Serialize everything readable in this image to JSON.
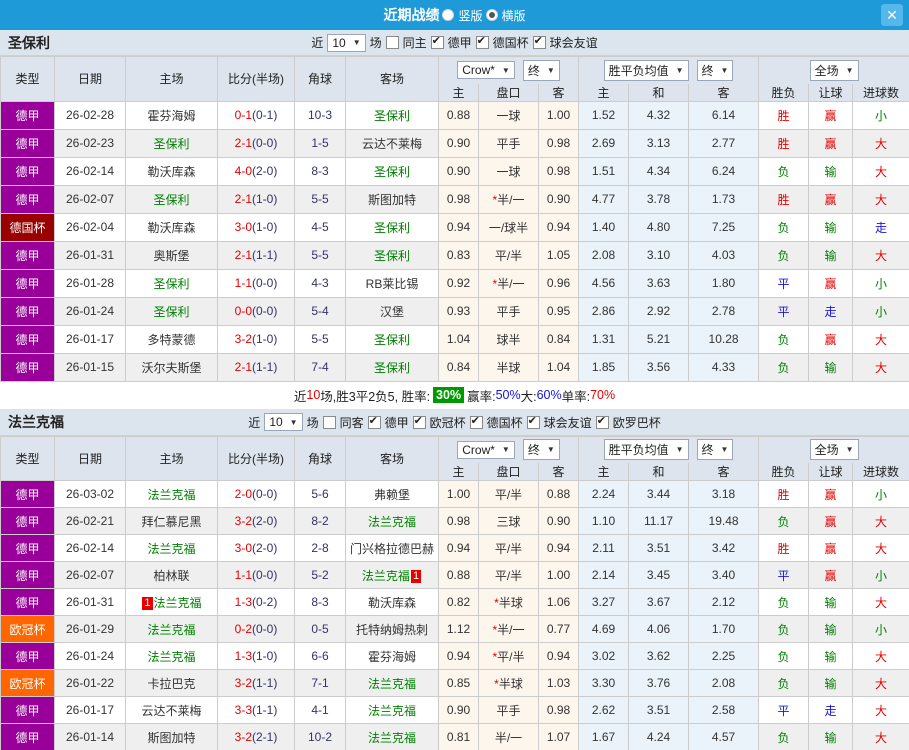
{
  "titlebar": {
    "title": "近期战绩",
    "radio_vertical": "竖版",
    "radio_horizontal": "横版",
    "selected": "横版",
    "close": "✕"
  },
  "colors": {
    "titlebar_blue": "#1e9ad8",
    "league": {
      "德甲": "#990099",
      "德国杯": "#990000",
      "欧冠杯": "#ff6600"
    },
    "result_map": {
      "胜": "#e60000",
      "负": "#008000",
      "平": "#1414dc",
      "赢": "#e60000",
      "输": "#008000",
      "走": "#1414dc",
      "大": "#e60000",
      "小": "#008000"
    },
    "team_green": "#008000",
    "score_red": "#e60000"
  },
  "table_header": {
    "main": [
      "类型",
      "日期",
      "主场",
      "比分(半场)",
      "角球",
      "客场"
    ],
    "sub": [
      "主",
      "盘口",
      "客",
      "主",
      "和",
      "客",
      "胜负",
      "让球",
      "进球数"
    ],
    "odds_source": "Crow*",
    "final1": "终",
    "mean_label": "胜平负均值",
    "final2": "终",
    "fulltime_label": "全场"
  },
  "sections": [
    {
      "team": "圣保利",
      "controls": {
        "near": "近",
        "count": "10",
        "games": "场",
        "same": {
          "label": "同主",
          "checked": false
        },
        "leagues": [
          {
            "label": "德甲",
            "checked": true
          },
          {
            "label": "德国杯",
            "checked": true
          },
          {
            "label": "球会友谊",
            "checked": true
          }
        ]
      },
      "rows": [
        {
          "type": "德甲",
          "date": "26-02-28",
          "home": "霍芬海姆",
          "home_green": false,
          "ft": "0-1",
          "ht": "(0-1)",
          "corner": "10-3",
          "away": "圣保利",
          "away_green": true,
          "o1": "0.88",
          "star": false,
          "hc": "一球",
          "o2": "1.00",
          "m1": "1.52",
          "m2": "4.32",
          "m3": "6.14",
          "res": "胜",
          "hres": "赢",
          "goals": "小"
        },
        {
          "type": "德甲",
          "date": "26-02-23",
          "home": "圣保利",
          "home_green": true,
          "ft": "2-1",
          "ht": "(0-0)",
          "corner": "1-5",
          "away": "云达不莱梅",
          "away_green": false,
          "o1": "0.90",
          "star": false,
          "hc": "平手",
          "o2": "0.98",
          "m1": "2.69",
          "m2": "3.13",
          "m3": "2.77",
          "res": "胜",
          "hres": "赢",
          "goals": "大"
        },
        {
          "type": "德甲",
          "date": "26-02-14",
          "home": "勒沃库森",
          "home_green": false,
          "ft": "4-0",
          "ht": "(2-0)",
          "corner": "8-3",
          "away": "圣保利",
          "away_green": true,
          "o1": "0.90",
          "star": false,
          "hc": "一球",
          "o2": "0.98",
          "m1": "1.51",
          "m2": "4.34",
          "m3": "6.24",
          "res": "负",
          "hres": "输",
          "goals": "大"
        },
        {
          "type": "德甲",
          "date": "26-02-07",
          "home": "圣保利",
          "home_green": true,
          "ft": "2-1",
          "ht": "(1-0)",
          "corner": "5-5",
          "away": "斯图加特",
          "away_green": false,
          "o1": "0.98",
          "star": true,
          "hc": "半/一",
          "o2": "0.90",
          "m1": "4.77",
          "m2": "3.78",
          "m3": "1.73",
          "res": "胜",
          "hres": "赢",
          "goals": "大"
        },
        {
          "type": "德国杯",
          "date": "26-02-04",
          "home": "勒沃库森",
          "home_green": false,
          "ft": "3-0",
          "ht": "(1-0)",
          "corner": "4-5",
          "away": "圣保利",
          "away_green": true,
          "o1": "0.94",
          "star": false,
          "hc": "一/球半",
          "o2": "0.94",
          "m1": "1.40",
          "m2": "4.80",
          "m3": "7.25",
          "res": "负",
          "hres": "输",
          "goals": "走"
        },
        {
          "type": "德甲",
          "date": "26-01-31",
          "home": "奥斯堡",
          "home_green": false,
          "ft": "2-1",
          "ht": "(1-1)",
          "corner": "5-5",
          "away": "圣保利",
          "away_green": true,
          "o1": "0.83",
          "star": false,
          "hc": "平/半",
          "o2": "1.05",
          "m1": "2.08",
          "m2": "3.10",
          "m3": "4.03",
          "res": "负",
          "hres": "输",
          "goals": "大"
        },
        {
          "type": "德甲",
          "date": "26-01-28",
          "home": "圣保利",
          "home_green": true,
          "ft": "1-1",
          "ht": "(0-0)",
          "corner": "4-3",
          "away": "RB莱比锡",
          "away_green": false,
          "o1": "0.92",
          "star": true,
          "hc": "半/一",
          "o2": "0.96",
          "m1": "4.56",
          "m2": "3.63",
          "m3": "1.80",
          "res": "平",
          "hres": "赢",
          "goals": "小"
        },
        {
          "type": "德甲",
          "date": "26-01-24",
          "home": "圣保利",
          "home_green": true,
          "ft": "0-0",
          "ht": "(0-0)",
          "corner": "5-4",
          "away": "汉堡",
          "away_green": false,
          "o1": "0.93",
          "star": false,
          "hc": "平手",
          "o2": "0.95",
          "m1": "2.86",
          "m2": "2.92",
          "m3": "2.78",
          "res": "平",
          "hres": "走",
          "goals": "小"
        },
        {
          "type": "德甲",
          "date": "26-01-17",
          "home": "多特蒙德",
          "home_green": false,
          "ft": "3-2",
          "ht": "(1-0)",
          "corner": "5-5",
          "away": "圣保利",
          "away_green": true,
          "o1": "1.04",
          "star": false,
          "hc": "球半",
          "o2": "0.84",
          "m1": "1.31",
          "m2": "5.21",
          "m3": "10.28",
          "res": "负",
          "hres": "赢",
          "goals": "大"
        },
        {
          "type": "德甲",
          "date": "26-01-15",
          "home": "沃尔夫斯堡",
          "home_green": false,
          "ft": "2-1",
          "ht": "(1-1)",
          "corner": "7-4",
          "away": "圣保利",
          "away_green": true,
          "o1": "0.84",
          "star": false,
          "hc": "半球",
          "o2": "1.04",
          "m1": "1.85",
          "m2": "3.56",
          "m3": "4.33",
          "res": "负",
          "hres": "输",
          "goals": "大"
        }
      ],
      "summary": [
        {
          "t": "近",
          "c": "k"
        },
        {
          "t": "10",
          "c": "r"
        },
        {
          "t": "场,胜3平2负5, 胜率: ",
          "c": "k"
        },
        {
          "t": "30%",
          "c": "badge"
        },
        {
          "t": " 赢率:",
          "c": "k"
        },
        {
          "t": "50%",
          "c": "b"
        },
        {
          "t": " 大:",
          "c": "k"
        },
        {
          "t": "60%",
          "c": "b"
        },
        {
          "t": " 单率:",
          "c": "k"
        },
        {
          "t": "70%",
          "c": "r"
        }
      ]
    },
    {
      "team": "法兰克福",
      "controls": {
        "near": "近",
        "count": "10",
        "games": "场",
        "same": {
          "label": "同客",
          "checked": false
        },
        "leagues": [
          {
            "label": "德甲",
            "checked": true
          },
          {
            "label": "欧冠杯",
            "checked": true
          },
          {
            "label": "德国杯",
            "checked": true
          },
          {
            "label": "球会友谊",
            "checked": true
          },
          {
            "label": "欧罗巴杯",
            "checked": true
          }
        ]
      },
      "rows": [
        {
          "type": "德甲",
          "date": "26-03-02",
          "home": "法兰克福",
          "home_green": true,
          "ft": "2-0",
          "ht": "(0-0)",
          "corner": "5-6",
          "away": "弗赖堡",
          "away_green": false,
          "o1": "1.00",
          "star": false,
          "hc": "平/半",
          "o2": "0.88",
          "m1": "2.24",
          "m2": "3.44",
          "m3": "3.18",
          "res": "胜",
          "hres": "赢",
          "goals": "小"
        },
        {
          "type": "德甲",
          "date": "26-02-21",
          "home": "拜仁慕尼黑",
          "home_green": false,
          "ft": "3-2",
          "ht": "(2-0)",
          "corner": "8-2",
          "away": "法兰克福",
          "away_green": true,
          "o1": "0.98",
          "star": false,
          "hc": "三球",
          "o2": "0.90",
          "m1": "1.10",
          "m2": "11.17",
          "m3": "19.48",
          "res": "负",
          "hres": "赢",
          "goals": "大"
        },
        {
          "type": "德甲",
          "date": "26-02-14",
          "home": "法兰克福",
          "home_green": true,
          "ft": "3-0",
          "ht": "(2-0)",
          "corner": "2-8",
          "away": "门兴格拉德巴赫",
          "away_green": false,
          "o1": "0.94",
          "star": false,
          "hc": "平/半",
          "o2": "0.94",
          "m1": "2.11",
          "m2": "3.51",
          "m3": "3.42",
          "res": "胜",
          "hres": "赢",
          "goals": "大"
        },
        {
          "type": "德甲",
          "date": "26-02-07",
          "home": "柏林联",
          "home_green": false,
          "ft": "1-1",
          "ht": "(0-0)",
          "corner": "5-2",
          "away": "法兰克福",
          "away_green": true,
          "away_badge": "1",
          "o1": "0.88",
          "star": false,
          "hc": "平/半",
          "o2": "1.00",
          "m1": "2.14",
          "m2": "3.45",
          "m3": "3.40",
          "res": "平",
          "hres": "赢",
          "goals": "小"
        },
        {
          "type": "德甲",
          "date": "26-01-31",
          "home": "法兰克福",
          "home_green": true,
          "home_badge": "1",
          "ft": "1-3",
          "ht": "(0-2)",
          "corner": "8-3",
          "away": "勒沃库森",
          "away_green": false,
          "o1": "0.82",
          "star": true,
          "hc": "半球",
          "o2": "1.06",
          "m1": "3.27",
          "m2": "3.67",
          "m3": "2.12",
          "res": "负",
          "hres": "输",
          "goals": "大"
        },
        {
          "type": "欧冠杯",
          "date": "26-01-29",
          "home": "法兰克福",
          "home_green": true,
          "ft": "0-2",
          "ht": "(0-0)",
          "corner": "0-5",
          "away": "托特纳姆热刺",
          "away_green": false,
          "o1": "1.12",
          "star": true,
          "hc": "半/一",
          "o2": "0.77",
          "m1": "4.69",
          "m2": "4.06",
          "m3": "1.70",
          "res": "负",
          "hres": "输",
          "goals": "小"
        },
        {
          "type": "德甲",
          "date": "26-01-24",
          "home": "法兰克福",
          "home_green": true,
          "ft": "1-3",
          "ht": "(1-0)",
          "corner": "6-6",
          "away": "霍芬海姆",
          "away_green": false,
          "o1": "0.94",
          "star": true,
          "hc": "平/半",
          "o2": "0.94",
          "m1": "3.02",
          "m2": "3.62",
          "m3": "2.25",
          "res": "负",
          "hres": "输",
          "goals": "大"
        },
        {
          "type": "欧冠杯",
          "date": "26-01-22",
          "home": "卡拉巴克",
          "home_green": false,
          "ft": "3-2",
          "ht": "(1-1)",
          "corner": "7-1",
          "away": "法兰克福",
          "away_green": true,
          "o1": "0.85",
          "star": true,
          "hc": "半球",
          "o2": "1.03",
          "m1": "3.30",
          "m2": "3.76",
          "m3": "2.08",
          "res": "负",
          "hres": "输",
          "goals": "大"
        },
        {
          "type": "德甲",
          "date": "26-01-17",
          "home": "云达不莱梅",
          "home_green": false,
          "ft": "3-3",
          "ht": "(1-1)",
          "corner": "4-1",
          "away": "法兰克福",
          "away_green": true,
          "o1": "0.90",
          "star": false,
          "hc": "平手",
          "o2": "0.98",
          "m1": "2.62",
          "m2": "3.51",
          "m3": "2.58",
          "res": "平",
          "hres": "走",
          "goals": "大"
        },
        {
          "type": "德甲",
          "date": "26-01-14",
          "home": "斯图加特",
          "home_green": false,
          "ft": "3-2",
          "ht": "(2-1)",
          "corner": "10-2",
          "away": "法兰克福",
          "away_green": true,
          "o1": "0.81",
          "star": false,
          "hc": "半/一",
          "o2": "1.07",
          "m1": "1.67",
          "m2": "4.24",
          "m3": "4.57",
          "res": "负",
          "hres": "输",
          "goals": "大"
        }
      ],
      "summary": null
    }
  ]
}
